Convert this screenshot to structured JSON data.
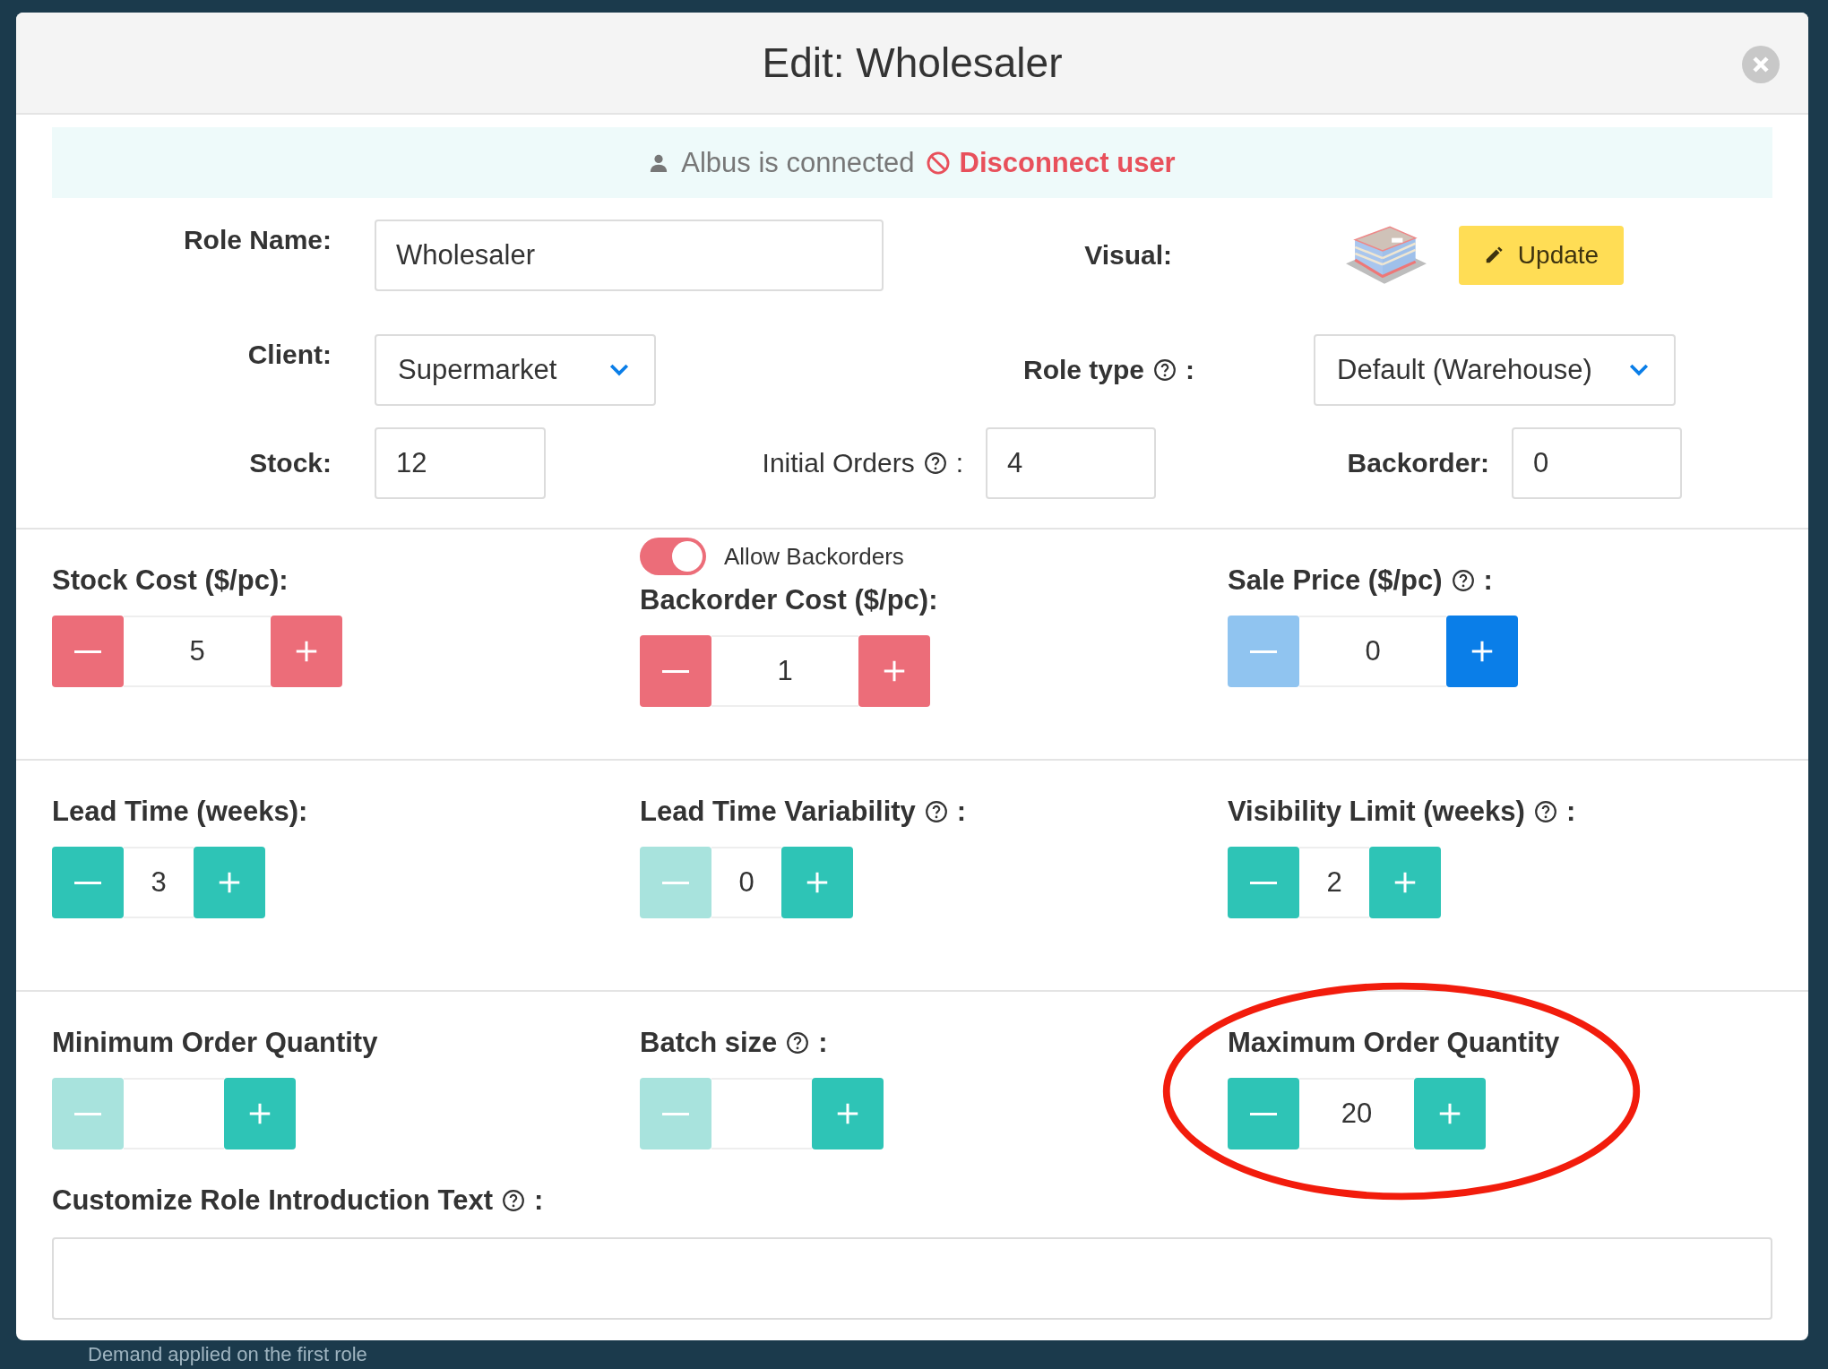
{
  "modal": {
    "title": "Edit: Wholesaler"
  },
  "banner": {
    "user_text": "Albus is connected",
    "action": "Disconnect user"
  },
  "role_name": {
    "label": "Role Name:",
    "value": "Wholesaler"
  },
  "visual": {
    "label": "Visual:",
    "button": "Update"
  },
  "client": {
    "label": "Client:",
    "value": "Supermarket"
  },
  "role_type": {
    "label": "Role type",
    "help": true,
    "suffix": ":",
    "value": "Default (Warehouse)"
  },
  "stock": {
    "label": "Stock:",
    "value": "12"
  },
  "initial_orders": {
    "label": "Initial Orders",
    "help": true,
    "suffix": ":",
    "value": "4"
  },
  "backorder": {
    "label": "Backorder:",
    "value": "0"
  },
  "sections": [
    {
      "fields": [
        {
          "label": "Stock Cost ($/pc):",
          "kind": "red",
          "value": "5",
          "minus_disabled": false
        },
        {
          "toggle": {
            "label": "Allow Backorders",
            "on": true
          },
          "label": "Backorder Cost ($/pc):",
          "kind": "red",
          "value": "1",
          "minus_disabled": false
        },
        {
          "label": "Sale Price ($/pc)",
          "help": true,
          "suffix": ":",
          "kind": "blue",
          "value": "0",
          "minus_disabled": true
        }
      ]
    },
    {
      "fields": [
        {
          "label": "Lead Time (weeks):",
          "kind": "teal",
          "value": "3",
          "minus_disabled": false
        },
        {
          "label": "Lead Time Variability",
          "help": true,
          "suffix": ":",
          "kind": "teal",
          "value": "0",
          "minus_disabled": true
        },
        {
          "label": "Visibility Limit (weeks)",
          "help": true,
          "suffix": ":",
          "kind": "teal",
          "value": "2",
          "minus_disabled": false
        }
      ]
    },
    {
      "fields": [
        {
          "label": "Minimum Order Quantity",
          "kind": "teal",
          "minus_disabled": true
        },
        {
          "label": "Batch size",
          "help": true,
          "suffix": ":",
          "kind": "teal",
          "minus_disabled": true
        },
        {
          "label": "Maximum Order Quantity",
          "kind": "teal",
          "value": "20",
          "minus_disabled": false,
          "highlighted": true
        }
      ]
    }
  ],
  "intro": {
    "label": "Customize Role Introduction Text",
    "help": true,
    "suffix": ":"
  },
  "background": {
    "text": "Demand applied on the first role"
  }
}
